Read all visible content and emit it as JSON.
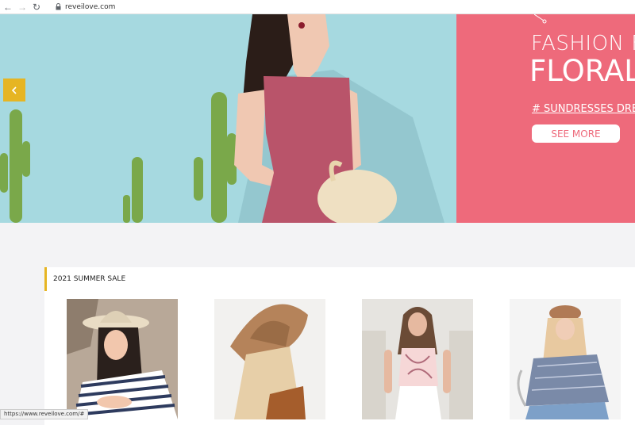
{
  "browser": {
    "url": "reveilove.com",
    "status_url": "https://www.reveilove.com/#"
  },
  "hero": {
    "promo_line1": "FASHION FI",
    "promo_line2": "FLORAL F",
    "promo_tag": "# SUNDRESSES DRESS",
    "see_more_label": "SEE MORE",
    "prev_icon": "chevron-left-icon"
  },
  "section": {
    "title": "2021 SUMMER SALE"
  },
  "products": [
    {
      "image": "woman-straw-hat-striped-top"
    },
    {
      "image": "woman-brown-hat-back-view"
    },
    {
      "image": "woman-scarf-top-white-jeans"
    },
    {
      "image": "woman-beret-denim-shirt"
    }
  ],
  "colors": {
    "accent": "#e6b523",
    "promo_bg": "#ee6a7b",
    "hero_bg": "#a6d9e0"
  }
}
